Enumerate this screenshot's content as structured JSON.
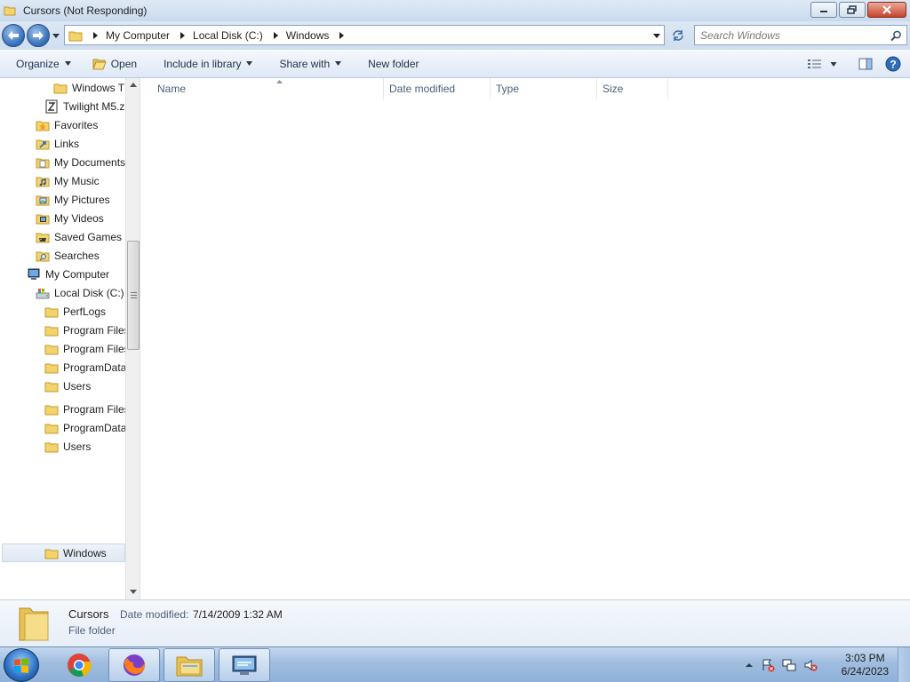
{
  "window": {
    "title": "Cursors (Not Responding)"
  },
  "address": {
    "crumbs": [
      "My Computer",
      "Local Disk (C:)",
      "Windows"
    ]
  },
  "search": {
    "placeholder": "Search Windows"
  },
  "toolbar": {
    "organize": "Organize",
    "open": "Open",
    "include_in_library": "Include in library",
    "share_with": "Share with",
    "new_folder": "New folder",
    "help": "?"
  },
  "nav": {
    "items": [
      {
        "label": "Windows T",
        "icon": "folder-icon"
      },
      {
        "label": "Twilight M5.z",
        "icon": "zip-file-icon"
      },
      {
        "label": "Favorites",
        "icon": "favorites-folder-icon"
      },
      {
        "label": "Links",
        "icon": "links-folder-icon"
      },
      {
        "label": "My Documents",
        "icon": "documents-folder-icon"
      },
      {
        "label": "My Music",
        "icon": "music-folder-icon"
      },
      {
        "label": "My Pictures",
        "icon": "pictures-folder-icon"
      },
      {
        "label": "My Videos",
        "icon": "videos-folder-icon"
      },
      {
        "label": "Saved Games",
        "icon": "saved-games-folder-icon"
      },
      {
        "label": "Searches",
        "icon": "searches-folder-icon"
      },
      {
        "label": "My Computer",
        "icon": "computer-icon"
      },
      {
        "label": "Local Disk (C:)",
        "icon": "drive-icon"
      },
      {
        "label": "PerfLogs",
        "icon": "folder-icon"
      },
      {
        "label": "Program Files",
        "icon": "folder-icon"
      },
      {
        "label": "Program Files",
        "icon": "folder-icon"
      },
      {
        "label": "ProgramData",
        "icon": "folder-icon"
      },
      {
        "label": "Users",
        "icon": "folder-icon"
      },
      {
        "label": "Program Files",
        "icon": "folder-icon"
      },
      {
        "label": "ProgramData",
        "icon": "folder-icon"
      },
      {
        "label": "Users",
        "icon": "folder-icon"
      },
      {
        "label": "Windows",
        "icon": "folder-icon"
      }
    ]
  },
  "columns": [
    "Name",
    "Date modified",
    "Type",
    "Size"
  ],
  "details": {
    "name": "Cursors",
    "date_label": "Date modified:",
    "date_value": "7/14/2009 1:32 AM",
    "kind": "File folder"
  },
  "taskbar": {
    "apps": [
      "chrome-icon",
      "firefox-icon",
      "file-explorer-icon",
      "remote-desktop-icon"
    ],
    "time": "3:03 PM",
    "date": "6/24/2023"
  },
  "colors": {
    "accent": "#2f6db6",
    "folder": "#f3d36b",
    "close": "#c7432b"
  }
}
